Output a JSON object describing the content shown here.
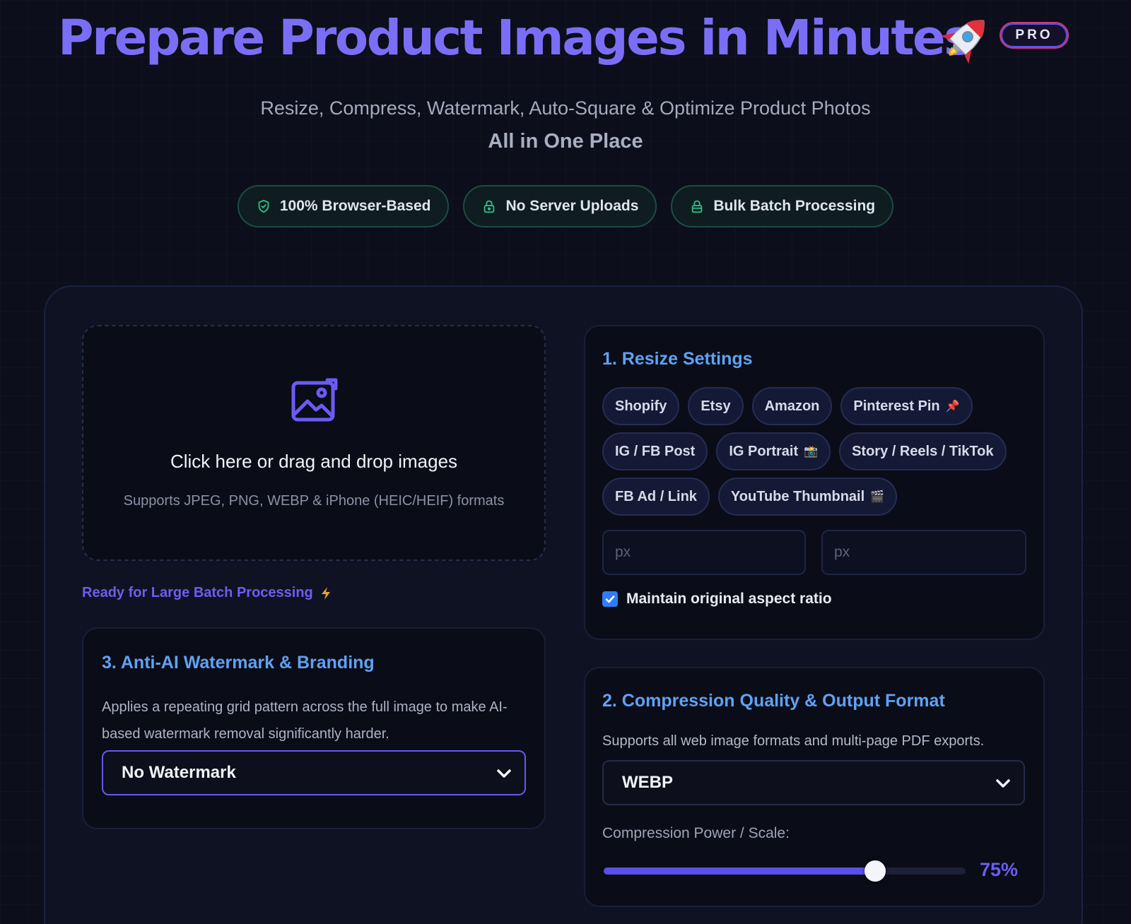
{
  "header": {
    "title": "Prepare Product Images in Minutes",
    "rocket_icon": "rocket-emoji",
    "badge": "PRO",
    "subtitle": "Resize, Compress, Watermark, Auto-Square & Optimize Product Photos",
    "subtitle_strong": "All in One Place",
    "features": [
      {
        "label": "100% Browser-Based",
        "icon": "shield-check-icon"
      },
      {
        "label": "No Server Uploads",
        "icon": "lock-icon"
      },
      {
        "label": "Bulk Batch Processing",
        "icon": "stack-icon"
      }
    ]
  },
  "dropzone": {
    "icon": "image-icon",
    "title": "Click here or drag and drop images",
    "subtitle": "Supports JPEG, PNG, WEBP & iPhone (HEIC/HEIF) formats"
  },
  "batch_note": {
    "label": "Ready for Large Batch Processing",
    "icon": "lightning-icon"
  },
  "watermark": {
    "title": "3. Anti-AI Watermark & Branding",
    "description": "Applies a repeating grid pattern across the full image to make AI-based watermark removal significantly harder.",
    "selected": "No Watermark"
  },
  "resize": {
    "title": "1. Resize Settings",
    "presets": [
      {
        "label": "Shopify",
        "emoji": ""
      },
      {
        "label": "Etsy",
        "emoji": ""
      },
      {
        "label": "Amazon",
        "emoji": ""
      },
      {
        "label": "Pinterest Pin",
        "emoji": "📌"
      },
      {
        "label": "IG / FB Post",
        "emoji": ""
      },
      {
        "label": "IG Portrait",
        "emoji": "📸"
      },
      {
        "label": "Story / Reels / TikTok",
        "emoji": ""
      },
      {
        "label": "FB Ad / Link",
        "emoji": ""
      },
      {
        "label": "YouTube Thumbnail",
        "emoji": "🎬"
      }
    ],
    "width_placeholder": "px",
    "height_placeholder": "px",
    "aspect_label": "Maintain original aspect ratio",
    "aspect_checked": true
  },
  "compression": {
    "title": "2. Compression Quality & Output Format",
    "description": "Supports all web image formats and multi-page PDF exports.",
    "format": "WEBP",
    "scale_label": "Compression Power / Scale:",
    "scale_value": 75,
    "scale_display": "75%"
  },
  "colors": {
    "accent": "#7b6ef6",
    "section_title": "#5fa2f4",
    "feature_border": "#1c4d3e",
    "checkbox": "#2f7df6"
  }
}
